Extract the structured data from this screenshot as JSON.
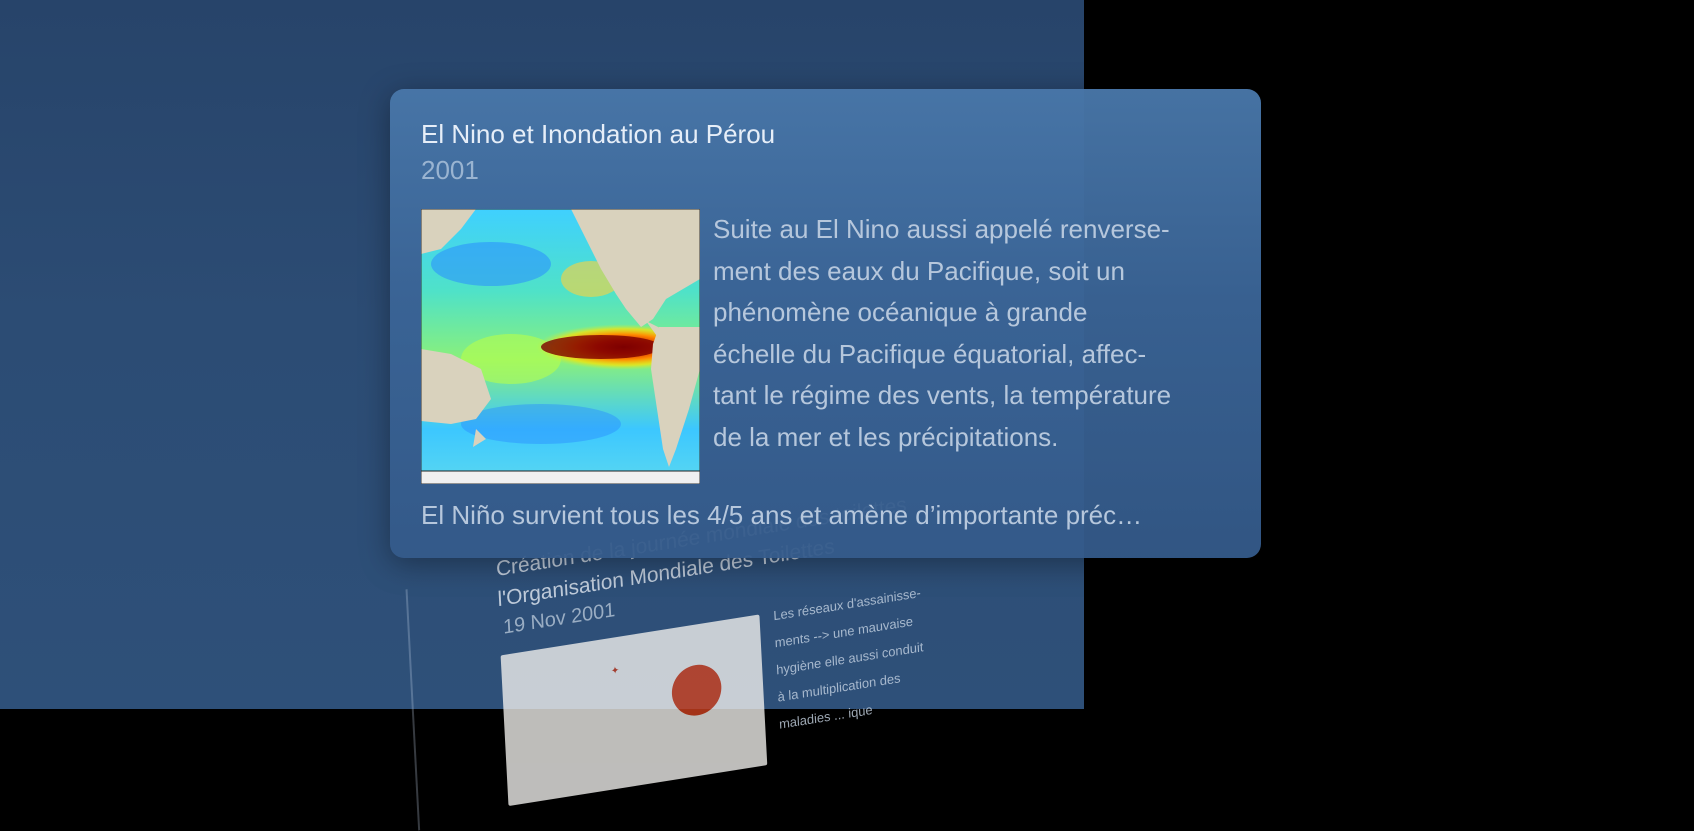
{
  "back_card": {
    "title_line1": "Création de la journée mondiale des toilettes",
    "title_line2": "l'Organisation Mondiale des Toilettes",
    "date": "19 Nov 2001",
    "body_lines": [
      "Les réseaux d'assainisse-",
      "ments --> une mauvaise",
      "hygiène elle aussi conduit",
      "à la multiplication des",
      "maladies ... ique"
    ]
  },
  "card": {
    "title": "El Nino et Inondation au Pérou",
    "year": "2001",
    "desc_lines": [
      "Suite au El Nino aussi appelé renverse-",
      "ment des eaux du Pacifique, soit un",
      "phénomène océanique à grande",
      "échelle du Pacifique équatorial, affec-",
      "tant le régime des vents, la température",
      "de la mer et les précipitations."
    ],
    "footer": "El Niño survient tous les 4/5 ans et amène d’importante préc…",
    "image_icon": "el-nino-sea-temperature-map"
  },
  "colors": {
    "background": "#000000",
    "panel": "#2b4a72",
    "card": "#4676a8",
    "title_text": "#e6eef8",
    "secondary_text": "#9ab4d1"
  }
}
